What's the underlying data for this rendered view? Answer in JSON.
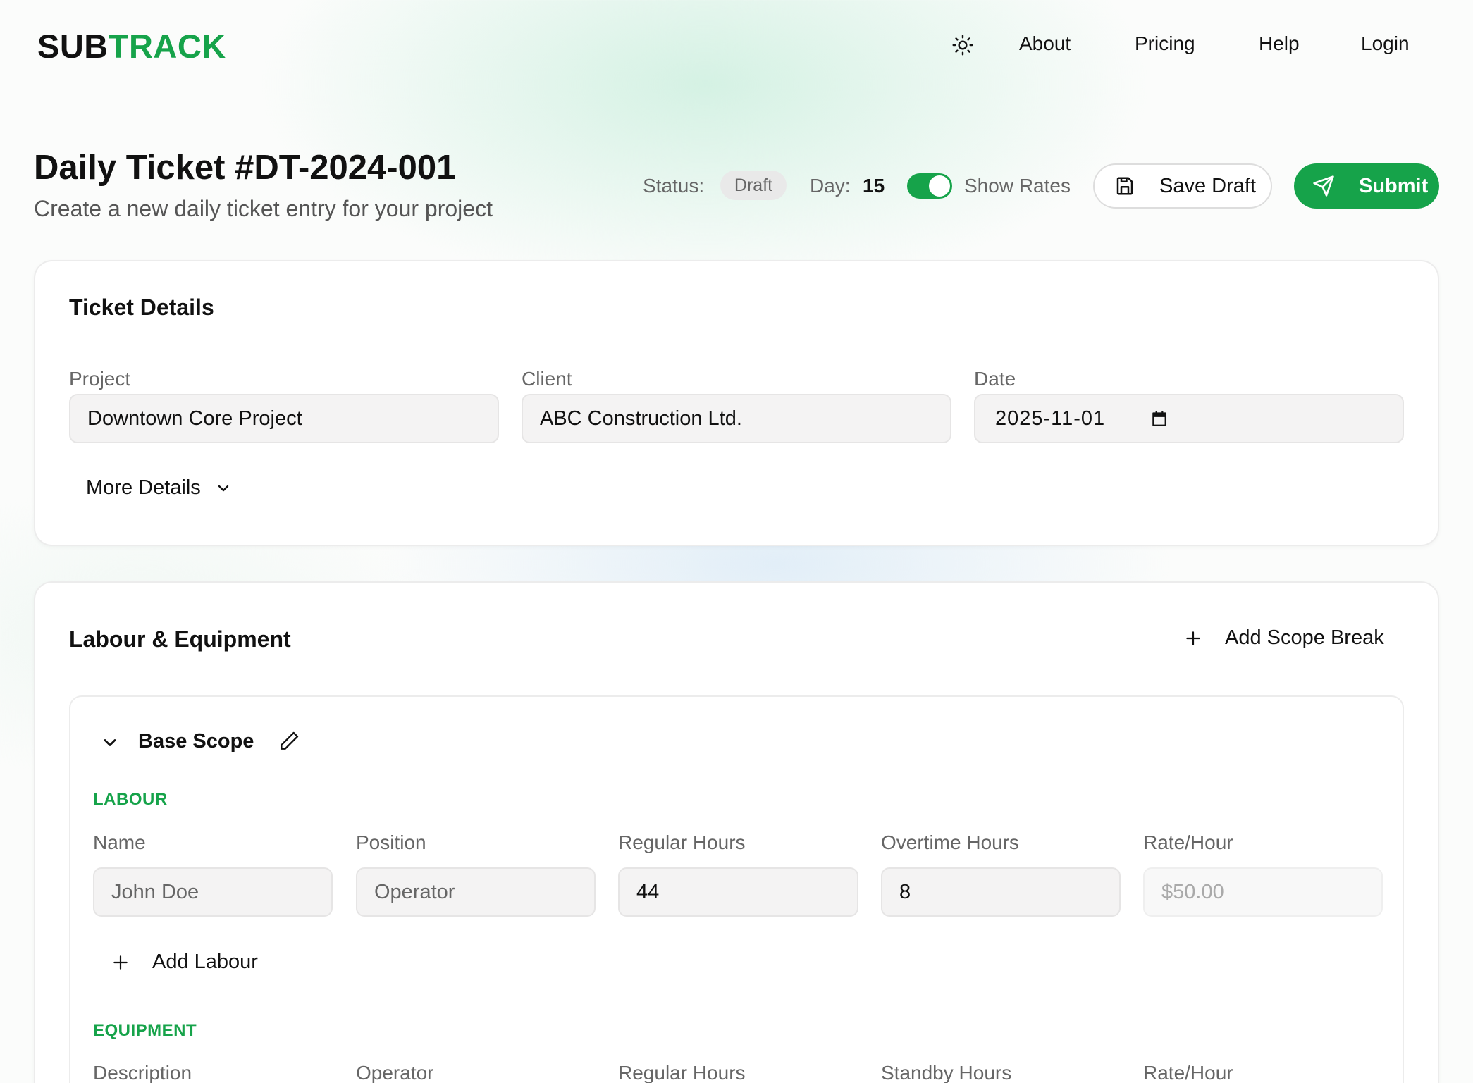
{
  "brand": {
    "part1": "SUB",
    "part2": "TRACK"
  },
  "nav": {
    "about": "About",
    "pricing": "Pricing",
    "help": "Help",
    "login": "Login"
  },
  "header": {
    "title": "Daily Ticket #DT-2024-001",
    "subtitle": "Create a new daily ticket entry for your project",
    "status_label": "Status:",
    "status_value": "Draft",
    "day_label": "Day:",
    "day_value": "15",
    "show_rates_label": "Show Rates",
    "show_rates_on": true,
    "save_draft": "Save Draft",
    "submit": "Submit"
  },
  "ticket_details": {
    "title": "Ticket Details",
    "project_label": "Project",
    "project_value": "Downtown Core Project",
    "client_label": "Client",
    "client_value": "ABC Construction Ltd.",
    "date_label": "Date",
    "date_value": "2025-11-01",
    "more_details": "More Details"
  },
  "labour_equipment": {
    "title": "Labour & Equipment",
    "add_scope_break": "Add Scope Break",
    "scope_name": "Base Scope",
    "labour": {
      "heading": "LABOUR",
      "columns": [
        "Name",
        "Position",
        "Regular Hours",
        "Overtime Hours",
        "Rate/Hour"
      ],
      "rows": [
        {
          "name": "John Doe",
          "position": "Operator",
          "regular_hours": "44",
          "overtime_hours": "8",
          "rate": "$50.00"
        }
      ],
      "add_label": "Add Labour"
    },
    "equipment": {
      "heading": "EQUIPMENT",
      "columns": [
        "Description",
        "Operator",
        "Regular Hours",
        "Standby Hours",
        "Rate/Hour"
      ]
    }
  },
  "colors": {
    "accent": "#16a34a"
  }
}
